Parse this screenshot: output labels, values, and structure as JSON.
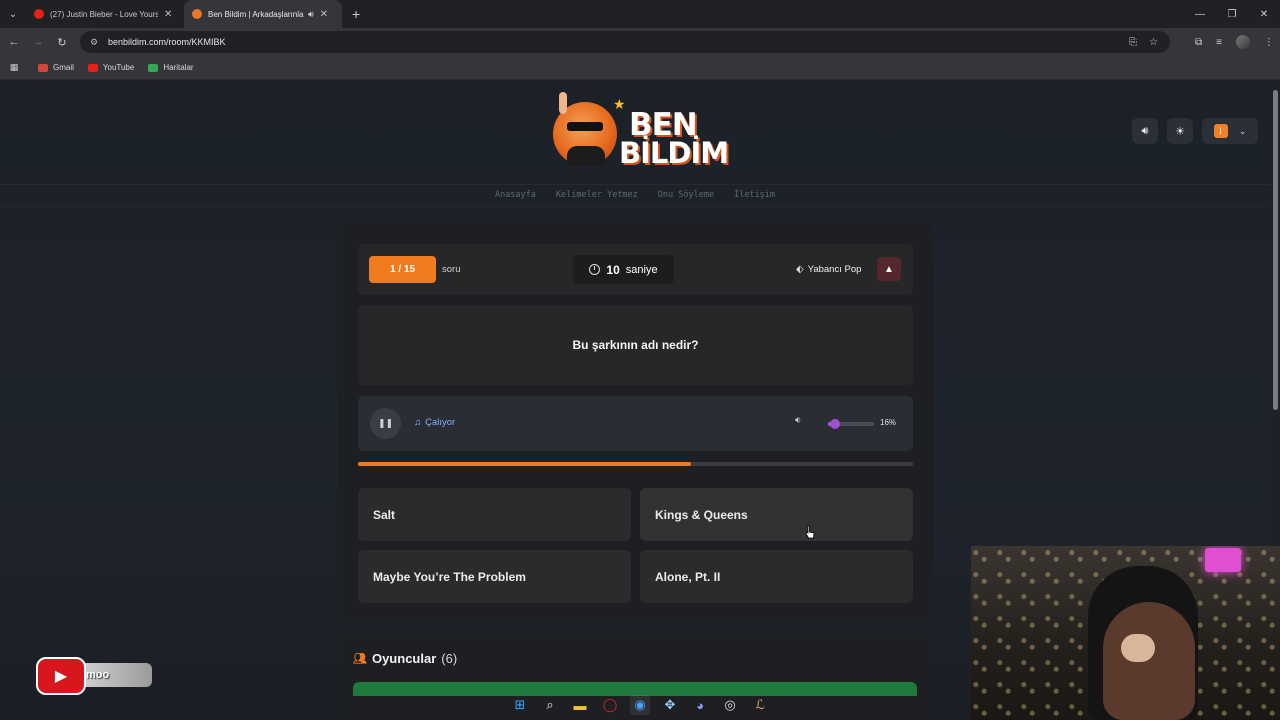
{
  "browser": {
    "tabs": [
      {
        "title": "(27) Justin Bieber - Love Yourself",
        "favicon": "youtube-icon",
        "active": false
      },
      {
        "title": "Ben Bildim | Arkadaşlarınla",
        "favicon": "benbildim-icon",
        "active": true
      }
    ],
    "url": "benbildim.com/room/KKMIBK",
    "bookmarks": [
      "Gmail",
      "YouTube",
      "Haritalar"
    ]
  },
  "site": {
    "logo_line1": "BEN",
    "logo_line2": "BİLDİM",
    "avatar_letter": "İ",
    "nav": [
      "Anasayfa",
      "Kelimeler Yetmez",
      "Onu Söyleme",
      "İletişim"
    ]
  },
  "game": {
    "question_counter": "1 / 15",
    "question_suffix": "soru",
    "timer_value": "10",
    "timer_unit": "saniye",
    "genre": "Yabancı Pop",
    "question": "Bu şarkının adı nedir?",
    "player_status": "Çalıyor",
    "volume_label": "16%",
    "volume_fraction": 0.16,
    "progress_fraction": 0.6,
    "answers": [
      "Salt",
      "Kings & Queens",
      "Maybe You’re The Problem",
      "Alone, Pt. II"
    ]
  },
  "players": {
    "title": "Oyuncular",
    "count": "(6)"
  },
  "overlay": {
    "yt_text": "moo"
  },
  "colors": {
    "accent": "#f17b1f",
    "volume": "#a24fd3",
    "playing": "#7fb0ff",
    "players_bar": "#1f7a3d"
  }
}
